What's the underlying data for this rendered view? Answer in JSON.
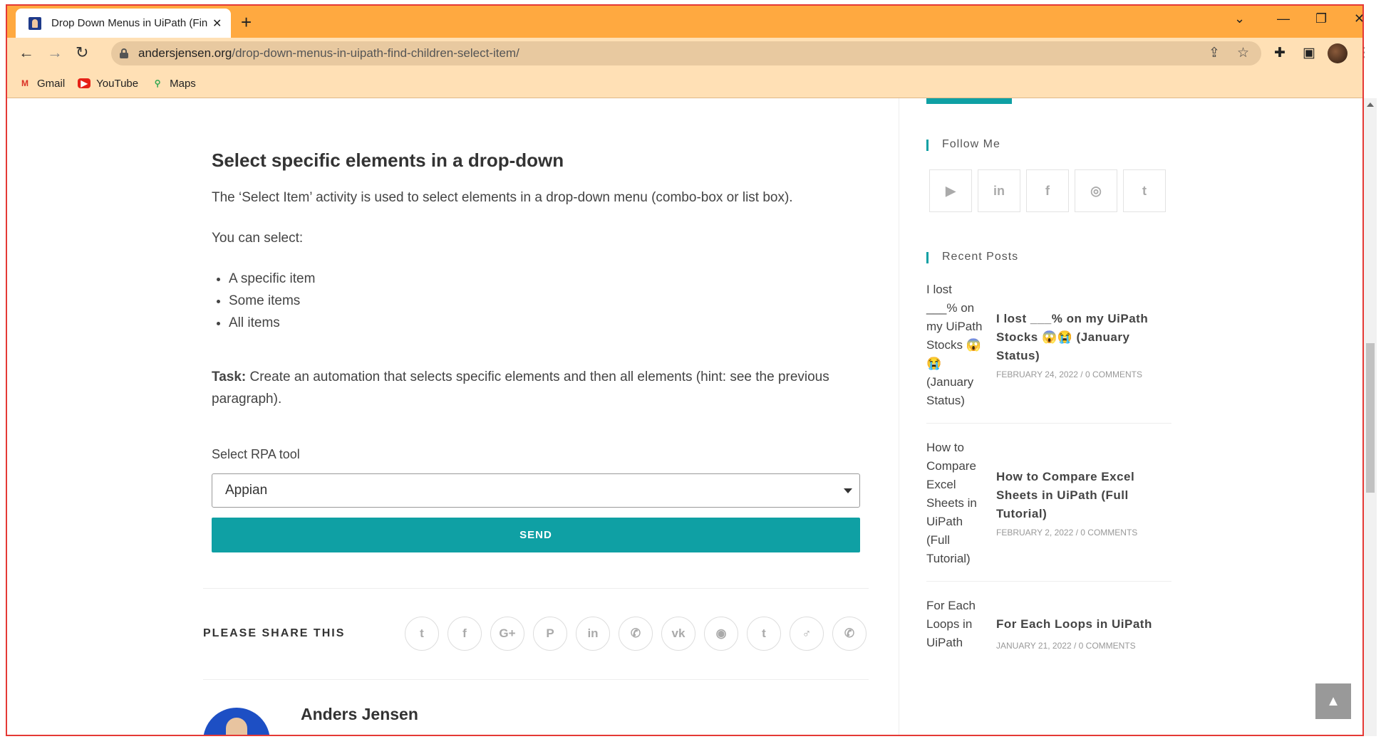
{
  "browser": {
    "tab_title": "Drop Down Menus in UiPath (Fin",
    "url_domain": "andersjensen.org",
    "url_path": "/drop-down-menus-in-uipath-find-children-select-item/",
    "bookmarks": [
      "Gmail",
      "YouTube",
      "Maps"
    ]
  },
  "article": {
    "heading": "Select specific elements in a drop-down",
    "intro": "The ‘Select Item’ activity is used to select elements in a drop-down menu (combo-box or list box).",
    "you_can_select": "You can select:",
    "items": [
      "A specific item",
      "Some items",
      "All items"
    ],
    "task_label": "Task:",
    "task_text": " Create an automation that selects specific elements and then all elements (hint: see the previous paragraph).",
    "select_label": "Select RPA tool",
    "select_value": "Appian",
    "send_label": "SEND",
    "share_label": "PLEASE SHARE THIS",
    "author_name": "Anders Jensen"
  },
  "sidebar": {
    "follow_title": "Follow Me",
    "recent_title": "Recent Posts",
    "posts": [
      {
        "thumb_alt": "I lost ___% on my UiPath Stocks 😱😭 (January Status)",
        "title": "I lost ___% on my UiPath Stocks 😱😭 (January Status)",
        "date": "FEBRUARY 24, 2022",
        "comments": "0 COMMENTS"
      },
      {
        "thumb_alt": "How to Compare Excel Sheets in UiPath (Full Tutorial)",
        "title": "How to Compare Excel Sheets in UiPath (Full Tutorial)",
        "date": "FEBRUARY 2, 2022",
        "comments": "0 COMMENTS"
      },
      {
        "thumb_alt": "For Each Loops in UiPath",
        "title": "For Each Loops in UiPath",
        "date": "JANUARY 21, 2022",
        "comments": "0 COMMENTS"
      }
    ]
  },
  "icons": {
    "share": [
      "twitter-icon",
      "facebook-icon",
      "google-plus-icon",
      "pinterest-icon",
      "linkedin-icon",
      "viber-icon",
      "vk-icon",
      "reddit-icon",
      "tumblr-icon",
      "viadeo-icon",
      "whatsapp-icon"
    ],
    "social": [
      "youtube-icon",
      "linkedin-icon",
      "facebook-icon",
      "instagram-icon",
      "twitter-icon"
    ]
  },
  "colors": {
    "accent": "#0fa0a4",
    "browser_bar": "#ffa940"
  }
}
